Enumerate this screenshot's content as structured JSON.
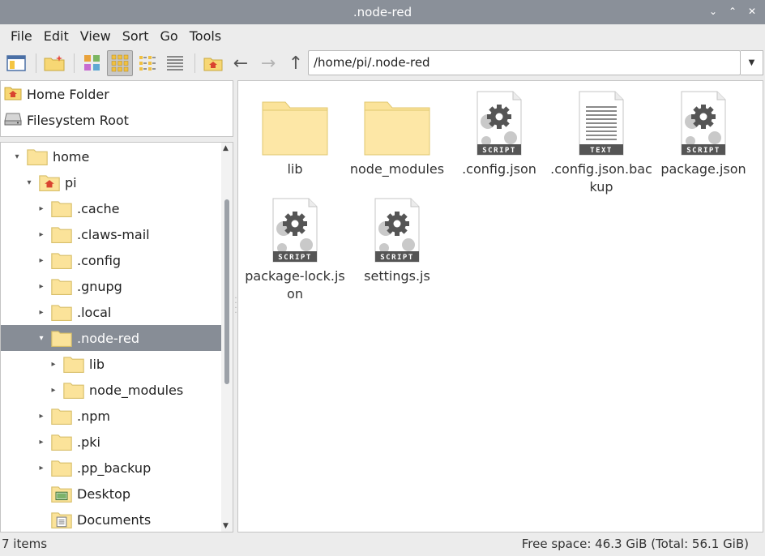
{
  "window": {
    "title": ".node-red"
  },
  "menu": [
    "File",
    "Edit",
    "View",
    "Sort",
    "Go",
    "Tools"
  ],
  "toolbar": {
    "path": "/home/pi/.node-red"
  },
  "places": [
    {
      "label": "Home Folder",
      "icon": "home-folder-icon"
    },
    {
      "label": "Filesystem Root",
      "icon": "drive-icon"
    }
  ],
  "tree": [
    {
      "label": "home",
      "level": 0,
      "exp": "open",
      "icon": "folder"
    },
    {
      "label": "pi",
      "level": 1,
      "exp": "open",
      "icon": "home-folder"
    },
    {
      "label": ".cache",
      "level": 2,
      "exp": "closed",
      "icon": "folder"
    },
    {
      "label": ".claws-mail",
      "level": 2,
      "exp": "closed",
      "icon": "folder"
    },
    {
      "label": ".config",
      "level": 2,
      "exp": "closed",
      "icon": "folder"
    },
    {
      "label": ".gnupg",
      "level": 2,
      "exp": "closed",
      "icon": "folder"
    },
    {
      "label": ".local",
      "level": 2,
      "exp": "closed",
      "icon": "folder"
    },
    {
      "label": ".node-red",
      "level": 2,
      "exp": "open",
      "icon": "folder",
      "selected": true
    },
    {
      "label": "lib",
      "level": 3,
      "exp": "closed",
      "icon": "folder"
    },
    {
      "label": "node_modules",
      "level": 3,
      "exp": "closed",
      "icon": "folder"
    },
    {
      "label": ".npm",
      "level": 2,
      "exp": "closed",
      "icon": "folder"
    },
    {
      "label": ".pki",
      "level": 2,
      "exp": "closed",
      "icon": "folder"
    },
    {
      "label": ".pp_backup",
      "level": 2,
      "exp": "closed",
      "icon": "folder"
    },
    {
      "label": "Desktop",
      "level": 2,
      "exp": "none",
      "icon": "desktop-folder"
    },
    {
      "label": "Documents",
      "level": 2,
      "exp": "none",
      "icon": "documents-folder"
    }
  ],
  "files": [
    {
      "name": "lib",
      "type": "folder"
    },
    {
      "name": "node_modules",
      "type": "folder"
    },
    {
      "name": ".config.json",
      "type": "script"
    },
    {
      "name": ".config.json.backup",
      "type": "text"
    },
    {
      "name": "package.json",
      "type": "script"
    },
    {
      "name": "package-lock.json",
      "type": "script"
    },
    {
      "name": "settings.js",
      "type": "script"
    }
  ],
  "badges": {
    "script": "SCRIPT",
    "text": "TEXT"
  },
  "status": {
    "items": "7 items",
    "free": "Free space: 46.3 GiB (Total: 56.1 GiB)"
  },
  "colors": {
    "accent": "#878d96",
    "titlebar": "#8a9099",
    "folder": "#fbe39a"
  }
}
